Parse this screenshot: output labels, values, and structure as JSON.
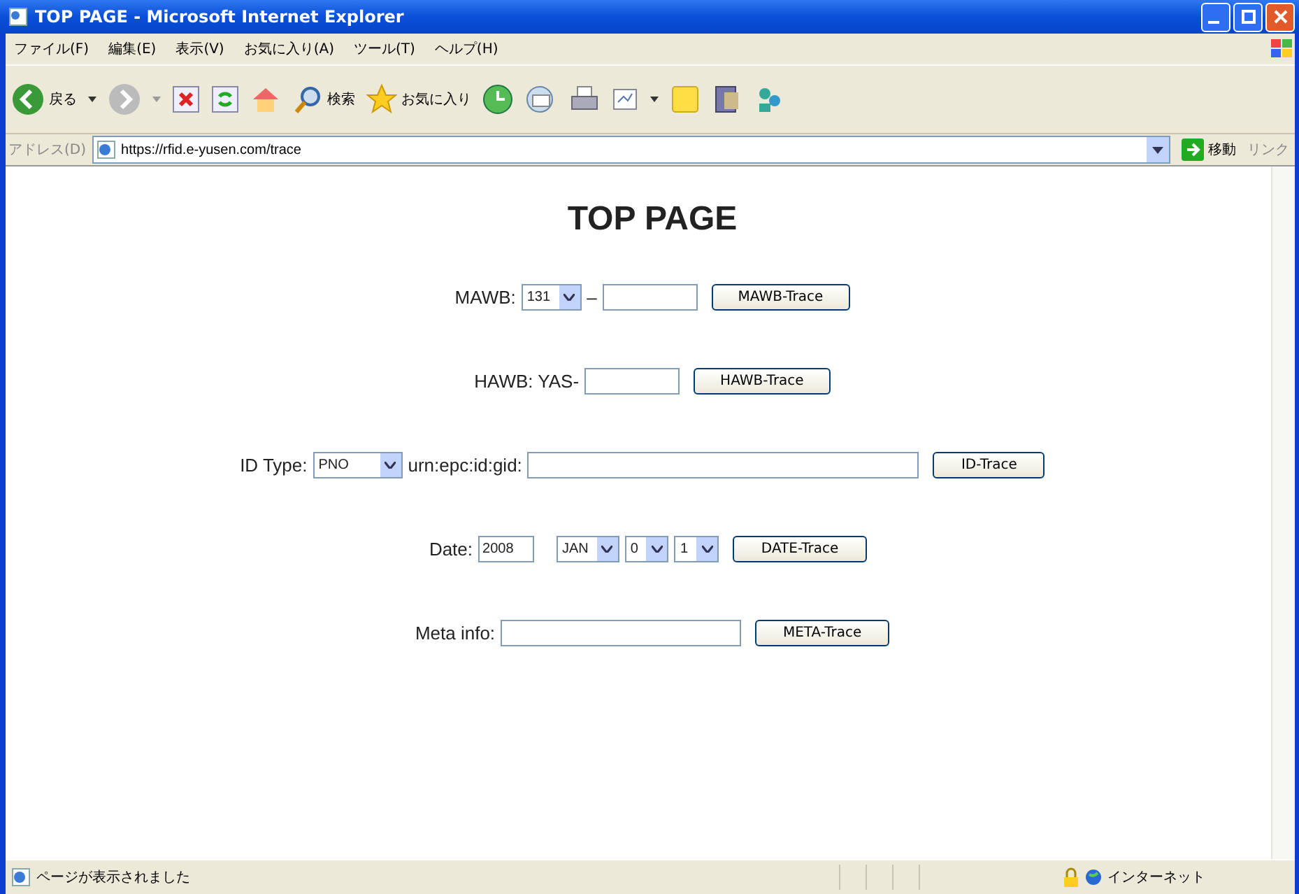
{
  "window": {
    "title": "TOP PAGE - Microsoft Internet Explorer"
  },
  "menu": [
    "ファイル(F)",
    "編集(E)",
    "表示(V)",
    "お気に入り(A)",
    "ツール(T)",
    "ヘルプ(H)"
  ],
  "toolbar": {
    "back": "戻る",
    "search": "検索",
    "favorites": "お気に入り"
  },
  "address_bar": {
    "label": "アドレス(D)",
    "url": "https://rfid.e-yusen.com/trace",
    "go": "移動",
    "links": "リンク"
  },
  "page": {
    "heading": "TOP PAGE",
    "rows": [
      {
        "kind": "mawb",
        "items": [
          {
            "kind": "label",
            "text": "MAWB:"
          },
          {
            "kind": "select",
            "value": "131"
          },
          {
            "kind": "label",
            "text": "–"
          },
          {
            "kind": "input"
          },
          {
            "kind": "button",
            "text": "MAWB-Trace"
          }
        ]
      },
      {
        "kind": "hawb",
        "items": [
          {
            "kind": "label",
            "text": "HAWB: YAS-"
          },
          {
            "kind": "input"
          },
          {
            "kind": "button",
            "text": "HAWB-Trace"
          }
        ]
      },
      {
        "kind": "id",
        "items": [
          {
            "kind": "label",
            "text": "ID Type:"
          },
          {
            "kind": "select",
            "value": "PNO"
          },
          {
            "kind": "label",
            "text": "urn:epc:id:gid:"
          },
          {
            "kind": "input"
          },
          {
            "kind": "button",
            "text": "ID-Trace"
          }
        ]
      },
      {
        "kind": "date",
        "items": [
          {
            "kind": "label",
            "text": "Date:"
          },
          {
            "kind": "input",
            "value": "2008"
          },
          {
            "kind": "select",
            "value": "JAN"
          },
          {
            "kind": "select",
            "value": "0"
          },
          {
            "kind": "select",
            "value": "1"
          },
          {
            "kind": "button",
            "text": "DATE-Trace"
          }
        ]
      },
      {
        "kind": "meta",
        "items": [
          {
            "kind": "label",
            "text": "Meta info:"
          },
          {
            "kind": "input"
          },
          {
            "kind": "button",
            "text": "META-Trace"
          }
        ]
      }
    ]
  },
  "status_bar": {
    "message": "ページが表示されました",
    "zone": "インターネット"
  }
}
